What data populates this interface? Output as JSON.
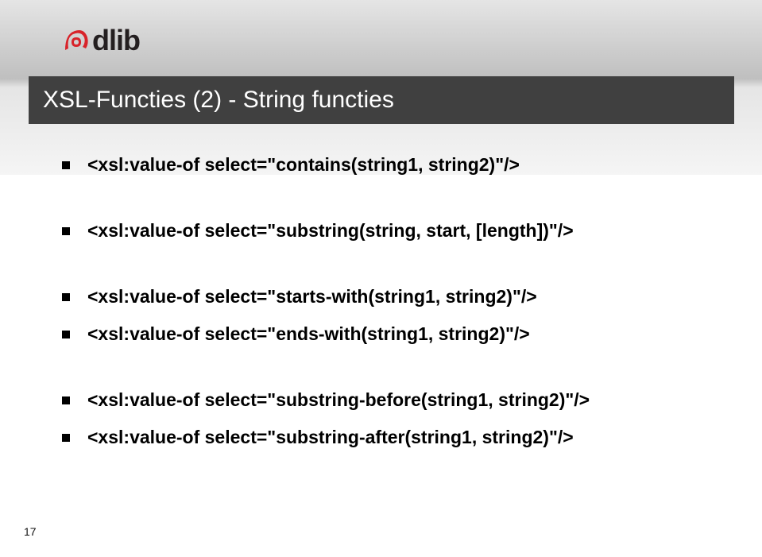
{
  "logo": {
    "text": "dlib"
  },
  "title": "XSL-Functies (2) - String functies",
  "bullets": [
    {
      "text": "<xsl:value-of select=\"contains(string1, string2)\"/>",
      "gap_after": true
    },
    {
      "text": "<xsl:value-of select=\"substring(string, start, [length])\"/>",
      "gap_after": true
    },
    {
      "text": "<xsl:value-of select=\"starts-with(string1, string2)\"/>",
      "gap_after": false
    },
    {
      "text": "<xsl:value-of select=\"ends-with(string1, string2)\"/>",
      "gap_after": true
    },
    {
      "text": "<xsl:value-of select=\"substring-before(string1, string2)\"/>",
      "gap_after": false
    },
    {
      "text": "<xsl:value-of select=\"substring-after(string1, string2)\"/>",
      "gap_after": false
    }
  ],
  "page_number": "17"
}
